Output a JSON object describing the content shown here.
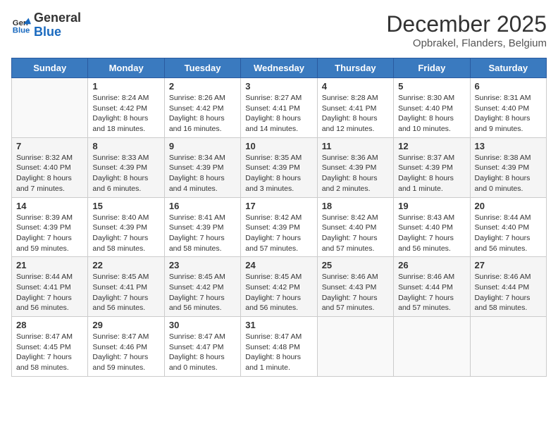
{
  "logo": {
    "general": "General",
    "blue": "Blue"
  },
  "title": "December 2025",
  "subtitle": "Opbrakel, Flanders, Belgium",
  "days_header": [
    "Sunday",
    "Monday",
    "Tuesday",
    "Wednesday",
    "Thursday",
    "Friday",
    "Saturday"
  ],
  "weeks": [
    [
      {
        "day": "",
        "info": ""
      },
      {
        "day": "1",
        "info": "Sunrise: 8:24 AM\nSunset: 4:42 PM\nDaylight: 8 hours\nand 18 minutes."
      },
      {
        "day": "2",
        "info": "Sunrise: 8:26 AM\nSunset: 4:42 PM\nDaylight: 8 hours\nand 16 minutes."
      },
      {
        "day": "3",
        "info": "Sunrise: 8:27 AM\nSunset: 4:41 PM\nDaylight: 8 hours\nand 14 minutes."
      },
      {
        "day": "4",
        "info": "Sunrise: 8:28 AM\nSunset: 4:41 PM\nDaylight: 8 hours\nand 12 minutes."
      },
      {
        "day": "5",
        "info": "Sunrise: 8:30 AM\nSunset: 4:40 PM\nDaylight: 8 hours\nand 10 minutes."
      },
      {
        "day": "6",
        "info": "Sunrise: 8:31 AM\nSunset: 4:40 PM\nDaylight: 8 hours\nand 9 minutes."
      }
    ],
    [
      {
        "day": "7",
        "info": "Sunrise: 8:32 AM\nSunset: 4:40 PM\nDaylight: 8 hours\nand 7 minutes."
      },
      {
        "day": "8",
        "info": "Sunrise: 8:33 AM\nSunset: 4:39 PM\nDaylight: 8 hours\nand 6 minutes."
      },
      {
        "day": "9",
        "info": "Sunrise: 8:34 AM\nSunset: 4:39 PM\nDaylight: 8 hours\nand 4 minutes."
      },
      {
        "day": "10",
        "info": "Sunrise: 8:35 AM\nSunset: 4:39 PM\nDaylight: 8 hours\nand 3 minutes."
      },
      {
        "day": "11",
        "info": "Sunrise: 8:36 AM\nSunset: 4:39 PM\nDaylight: 8 hours\nand 2 minutes."
      },
      {
        "day": "12",
        "info": "Sunrise: 8:37 AM\nSunset: 4:39 PM\nDaylight: 8 hours\nand 1 minute."
      },
      {
        "day": "13",
        "info": "Sunrise: 8:38 AM\nSunset: 4:39 PM\nDaylight: 8 hours\nand 0 minutes."
      }
    ],
    [
      {
        "day": "14",
        "info": "Sunrise: 8:39 AM\nSunset: 4:39 PM\nDaylight: 7 hours\nand 59 minutes."
      },
      {
        "day": "15",
        "info": "Sunrise: 8:40 AM\nSunset: 4:39 PM\nDaylight: 7 hours\nand 58 minutes."
      },
      {
        "day": "16",
        "info": "Sunrise: 8:41 AM\nSunset: 4:39 PM\nDaylight: 7 hours\nand 58 minutes."
      },
      {
        "day": "17",
        "info": "Sunrise: 8:42 AM\nSunset: 4:39 PM\nDaylight: 7 hours\nand 57 minutes."
      },
      {
        "day": "18",
        "info": "Sunrise: 8:42 AM\nSunset: 4:40 PM\nDaylight: 7 hours\nand 57 minutes."
      },
      {
        "day": "19",
        "info": "Sunrise: 8:43 AM\nSunset: 4:40 PM\nDaylight: 7 hours\nand 56 minutes."
      },
      {
        "day": "20",
        "info": "Sunrise: 8:44 AM\nSunset: 4:40 PM\nDaylight: 7 hours\nand 56 minutes."
      }
    ],
    [
      {
        "day": "21",
        "info": "Sunrise: 8:44 AM\nSunset: 4:41 PM\nDaylight: 7 hours\nand 56 minutes."
      },
      {
        "day": "22",
        "info": "Sunrise: 8:45 AM\nSunset: 4:41 PM\nDaylight: 7 hours\nand 56 minutes."
      },
      {
        "day": "23",
        "info": "Sunrise: 8:45 AM\nSunset: 4:42 PM\nDaylight: 7 hours\nand 56 minutes."
      },
      {
        "day": "24",
        "info": "Sunrise: 8:45 AM\nSunset: 4:42 PM\nDaylight: 7 hours\nand 56 minutes."
      },
      {
        "day": "25",
        "info": "Sunrise: 8:46 AM\nSunset: 4:43 PM\nDaylight: 7 hours\nand 57 minutes."
      },
      {
        "day": "26",
        "info": "Sunrise: 8:46 AM\nSunset: 4:44 PM\nDaylight: 7 hours\nand 57 minutes."
      },
      {
        "day": "27",
        "info": "Sunrise: 8:46 AM\nSunset: 4:44 PM\nDaylight: 7 hours\nand 58 minutes."
      }
    ],
    [
      {
        "day": "28",
        "info": "Sunrise: 8:47 AM\nSunset: 4:45 PM\nDaylight: 7 hours\nand 58 minutes."
      },
      {
        "day": "29",
        "info": "Sunrise: 8:47 AM\nSunset: 4:46 PM\nDaylight: 7 hours\nand 59 minutes."
      },
      {
        "day": "30",
        "info": "Sunrise: 8:47 AM\nSunset: 4:47 PM\nDaylight: 8 hours\nand 0 minutes."
      },
      {
        "day": "31",
        "info": "Sunrise: 8:47 AM\nSunset: 4:48 PM\nDaylight: 8 hours\nand 1 minute."
      },
      {
        "day": "",
        "info": ""
      },
      {
        "day": "",
        "info": ""
      },
      {
        "day": "",
        "info": ""
      }
    ]
  ]
}
